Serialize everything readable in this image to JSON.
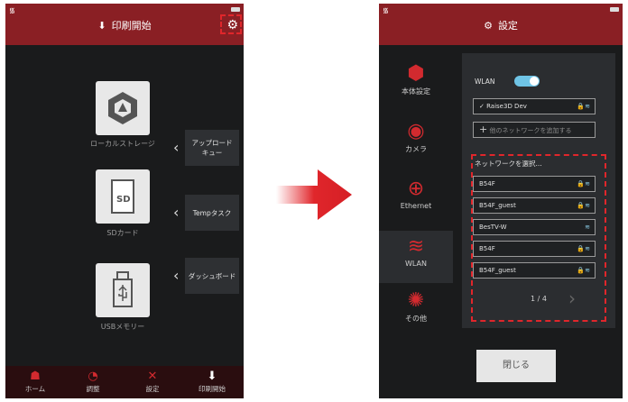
{
  "left": {
    "title": "印刷開始",
    "storage": [
      {
        "label": "ローカルストレージ",
        "icon": "local-storage-icon"
      },
      {
        "label": "SDカード",
        "icon": "sd-card-icon"
      },
      {
        "label": "USBメモリー",
        "icon": "usb-icon"
      }
    ],
    "drawers": [
      {
        "label": "アップロード\nキュー"
      },
      {
        "label": "Tempタスク"
      },
      {
        "label": "ダッシュボード"
      }
    ],
    "tabs": [
      {
        "label": "ホーム",
        "icon": "home-icon"
      },
      {
        "label": "調整",
        "icon": "adjust-icon"
      },
      {
        "label": "設定",
        "icon": "tools-icon"
      },
      {
        "label": "印刷開始",
        "icon": "print-icon"
      }
    ]
  },
  "right": {
    "title": "設定",
    "sidebar": [
      {
        "label": "本体設定",
        "icon": "machine-icon"
      },
      {
        "label": "カメラ",
        "icon": "camera-icon"
      },
      {
        "label": "Ethernet",
        "icon": "globe-icon"
      },
      {
        "label": "WLAN",
        "icon": "wifi-icon"
      },
      {
        "label": "その他",
        "icon": "gears-icon"
      }
    ],
    "wlan_label": "WLAN",
    "connected": "Raise3D Dev",
    "add_network": "他のネットワークを追加する",
    "select_network": "ネットワークを選択...",
    "networks": [
      "B54F",
      "B54F_guest",
      "BesTV-W",
      "B54F",
      "B54F_guest"
    ],
    "page": "1 / 4",
    "close": "閉じる"
  },
  "colors": {
    "accent": "#d22a2f",
    "topbar": "#8a1f24"
  }
}
